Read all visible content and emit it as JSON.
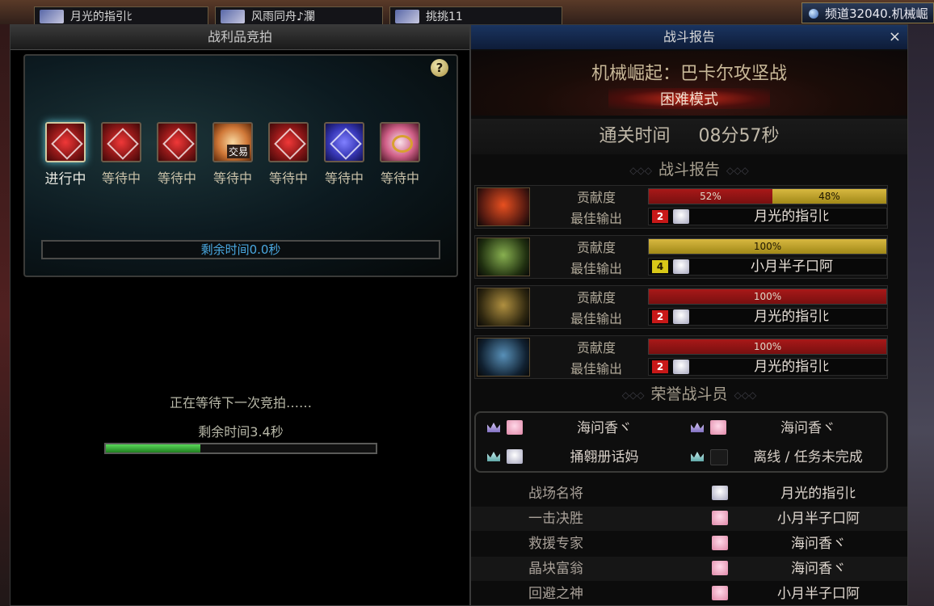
{
  "top_tabs": [
    {
      "label": "月光的指引ﾋ"
    },
    {
      "label": "风雨同舟♪瀾"
    },
    {
      "label": "挑挑11"
    }
  ],
  "channel": {
    "label": "频道32040.机械崛"
  },
  "loot": {
    "title": "战利品竞拍",
    "help": "?",
    "slots": [
      {
        "label": "进行中",
        "color": "red",
        "state": "active"
      },
      {
        "label": "等待中",
        "color": "red"
      },
      {
        "label": "等待中",
        "color": "red"
      },
      {
        "label": "等待中",
        "color": "orange",
        "tag": "交易"
      },
      {
        "label": "等待中",
        "color": "red"
      },
      {
        "label": "等待中",
        "color": "blue"
      },
      {
        "label": "等待中",
        "color": "pink"
      }
    ],
    "remaining": "剩余时间0.0秒",
    "waiting": "正在等待下一次竞拍……",
    "waiting_remaining": "剩余时间3.4秒",
    "waiting_progress": 0.35
  },
  "report": {
    "title": "战斗报告",
    "close": "×",
    "dungeon": "机械崛起：巴卡尔攻坚战",
    "mode": "困难模式",
    "clear_label": "通关时间",
    "clear_time": "08分57秒",
    "section_report": "战斗报告",
    "contribution_label": "贡献度",
    "best_dps_label": "最佳输出",
    "bosses": [
      {
        "colors": [
          "#e85020",
          "#501810"
        ],
        "segments": [
          {
            "pct": 52,
            "label": "52%",
            "color": "red"
          },
          {
            "pct": 48,
            "label": "48%",
            "color": "gold"
          }
        ],
        "best_rank": "2",
        "best_name": "月光的指引ﾋ"
      },
      {
        "colors": [
          "#88b050",
          "#203010"
        ],
        "segments": [
          {
            "pct": 100,
            "label": "100%",
            "color": "gold"
          }
        ],
        "best_rank": "4",
        "best_name": "小月半子口阿"
      },
      {
        "colors": [
          "#b09040",
          "#302810"
        ],
        "segments": [
          {
            "pct": 100,
            "label": "100%",
            "color": "red"
          }
        ],
        "best_rank": "2",
        "best_name": "月光的指引ﾋ"
      },
      {
        "colors": [
          "#5890b8",
          "#102030"
        ],
        "segments": [
          {
            "pct": 100,
            "label": "100%",
            "color": "red"
          }
        ],
        "best_rank": "2",
        "best_name": "月光的指引ﾋ"
      }
    ],
    "section_honor": "荣誉战斗员",
    "honor": [
      {
        "name": "海问香ヾ",
        "crown": "purple"
      },
      {
        "name": "海问香ヾ",
        "crown": "purple"
      },
      {
        "name": "捅翱册话妈",
        "crown": "teal"
      },
      {
        "name": "离线 / 任务未完成",
        "crown": "teal",
        "offline": true
      }
    ],
    "awards": [
      {
        "title": "战场名将",
        "player": "月光的指引ﾋ"
      },
      {
        "title": "一击决胜",
        "player": "小月半子口阿"
      },
      {
        "title": "救援专家",
        "player": "海问香ヾ"
      },
      {
        "title": "晶块富翁",
        "player": "海问香ヾ"
      },
      {
        "title": "回避之神",
        "player": "小月半子口阿"
      }
    ]
  }
}
